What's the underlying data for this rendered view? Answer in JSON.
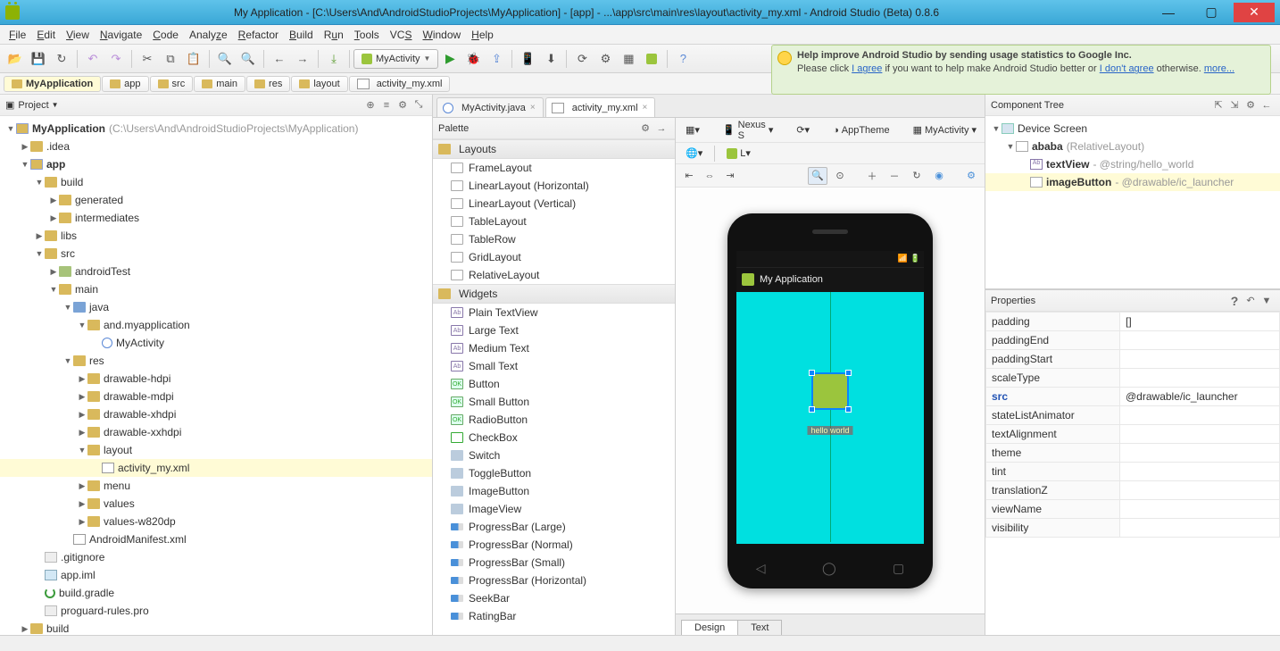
{
  "window": {
    "title": "My Application - [C:\\Users\\And\\AndroidStudioProjects\\MyApplication] - [app] - ...\\app\\src\\main\\res\\layout\\activity_my.xml - Android Studio (Beta) 0.8.6"
  },
  "menu": [
    "File",
    "Edit",
    "View",
    "Navigate",
    "Code",
    "Analyze",
    "Refactor",
    "Build",
    "Run",
    "Tools",
    "VCS",
    "Window",
    "Help"
  ],
  "runconfig": "MyActivity",
  "tip": {
    "title": "Help improve Android Studio by sending usage statistics to Google Inc.",
    "text1": "Please click ",
    "link1": "I agree",
    "text2": " if you want to help make Android Studio better or ",
    "link2": "I don't agree",
    "text3": " otherwise. ",
    "more": "more..."
  },
  "crumbs": [
    "MyApplication",
    "app",
    "src",
    "main",
    "res",
    "layout",
    "activity_my.xml"
  ],
  "projtool": "Project",
  "projroot": "MyApplication",
  "projhint": "(C:\\Users\\And\\AndroidStudioProjects\\MyApplication)",
  "tree": {
    "idea": ".idea",
    "app": "app",
    "build": "build",
    "generated": "generated",
    "intermediates": "intermediates",
    "libs": "libs",
    "src": "src",
    "atest": "androidTest",
    "main": "main",
    "java": "java",
    "pkg": "and.myapplication",
    "act": "MyActivity",
    "res": "res",
    "dh": "drawable-hdpi",
    "dm": "drawable-mdpi",
    "dxh": "drawable-xhdpi",
    "dxxh": "drawable-xxhdpi",
    "layout": "layout",
    "axml": "activity_my.xml",
    "menu": "menu",
    "values": "values",
    "valw": "values-w820dp",
    "manifest": "AndroidManifest.xml",
    "gitig": ".gitignore",
    "aiml": "app.iml",
    "bgrad": "build.gradle",
    "prog": "proguard-rules.pro",
    "build2": "build"
  },
  "tabs": {
    "java": "MyActivity.java",
    "xml": "activity_my.xml"
  },
  "palette": {
    "title": "Palette",
    "cats": {
      "layouts": "Layouts",
      "widgets": "Widgets"
    },
    "layouts": [
      "FrameLayout",
      "LinearLayout (Horizontal)",
      "LinearLayout (Vertical)",
      "TableLayout",
      "TableRow",
      "GridLayout",
      "RelativeLayout"
    ],
    "widgets": [
      "Plain TextView",
      "Large Text",
      "Medium Text",
      "Small Text",
      "Button",
      "Small Button",
      "RadioButton",
      "CheckBox",
      "Switch",
      "ToggleButton",
      "ImageButton",
      "ImageView",
      "ProgressBar (Large)",
      "ProgressBar (Normal)",
      "ProgressBar (Small)",
      "ProgressBar (Horizontal)",
      "SeekBar",
      "RatingBar"
    ]
  },
  "designbar": {
    "device": "Nexus S",
    "theme": "AppTheme",
    "activity": "MyActivity"
  },
  "preview": {
    "apptitle": "My Application",
    "hello": "hello world"
  },
  "dtabs": {
    "design": "Design",
    "text": "Text"
  },
  "ctree": {
    "title": "Component Tree",
    "root": "Device Screen",
    "rel": "ababa",
    "relhint": "(RelativeLayout)",
    "tv": "textView",
    "tvhint": "- @string/hello_world",
    "ib": "imageButton",
    "ibhint": "- @drawable/ic_launcher"
  },
  "props": {
    "title": "Properties",
    "rows": [
      {
        "k": "padding",
        "v": "[]"
      },
      {
        "k": "paddingEnd",
        "v": ""
      },
      {
        "k": "paddingStart",
        "v": ""
      },
      {
        "k": "scaleType",
        "v": ""
      },
      {
        "k": "src",
        "v": "@drawable/ic_launcher",
        "h": true
      },
      {
        "k": "stateListAnimator",
        "v": ""
      },
      {
        "k": "textAlignment",
        "v": ""
      },
      {
        "k": "theme",
        "v": ""
      },
      {
        "k": "tint",
        "v": ""
      },
      {
        "k": "translationZ",
        "v": ""
      },
      {
        "k": "viewName",
        "v": ""
      },
      {
        "k": "visibility",
        "v": ""
      }
    ]
  }
}
